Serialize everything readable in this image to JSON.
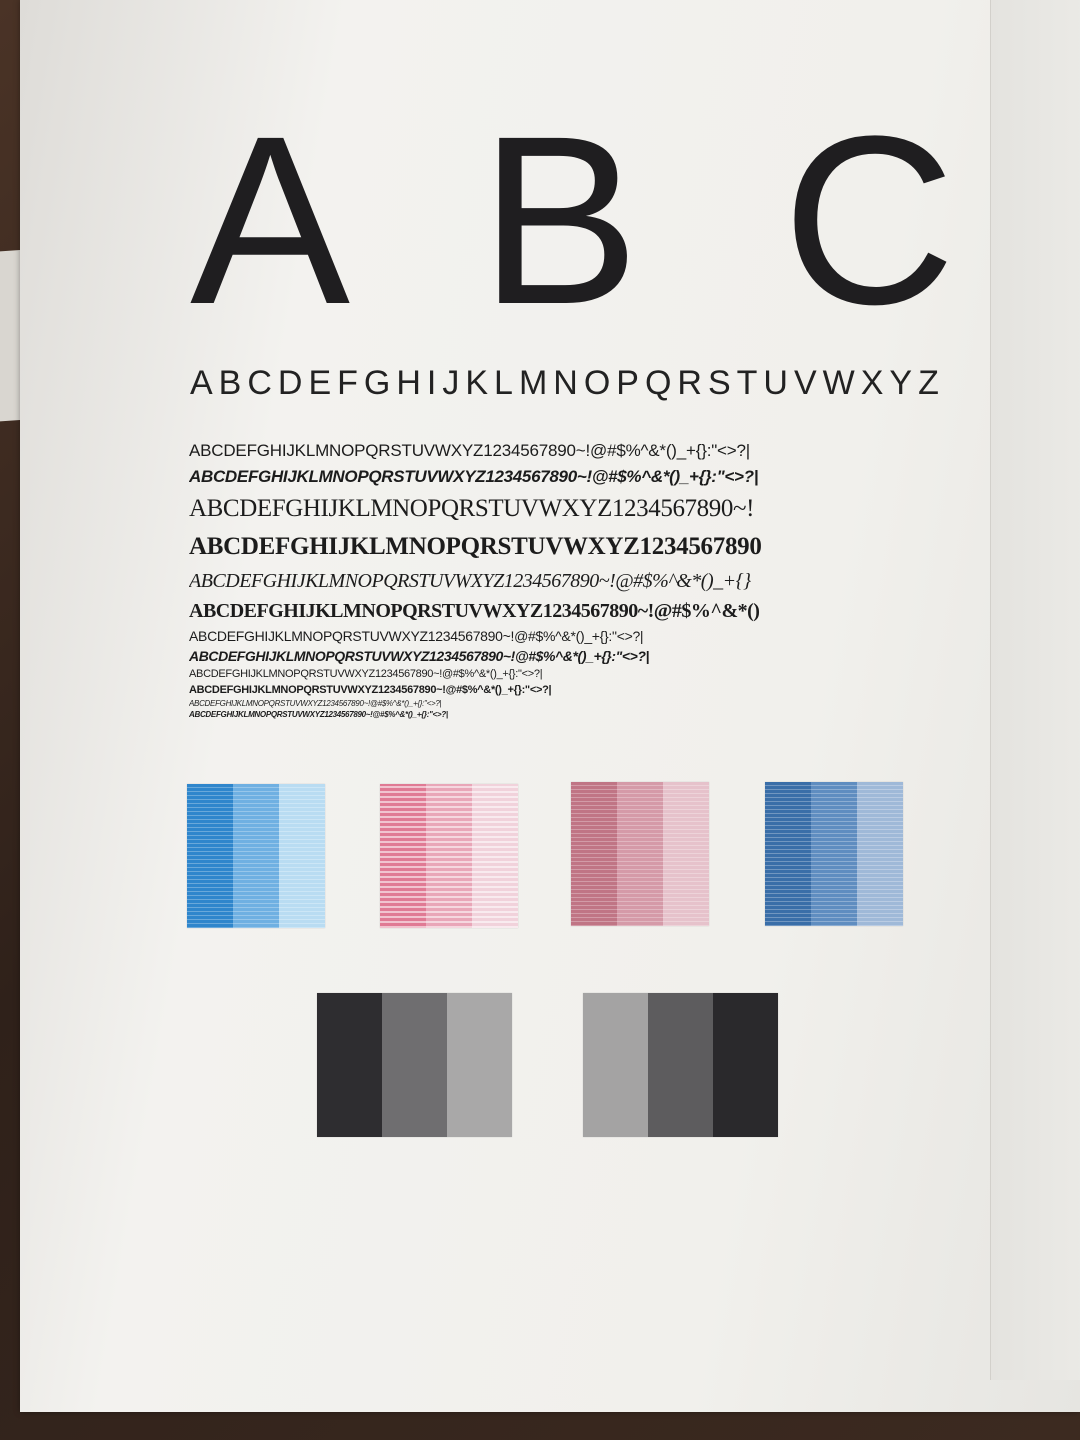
{
  "print_test": {
    "big_letters": "A B C",
    "alphabet_line": "ABCDEFGHIJKLMNOPQRSTUVWXYZ",
    "font_lines": [
      "ABCDEFGHIJKLMNOPQRSTUVWXYZ1234567890~!@#$%^&*()_+{}:\"<>?|",
      "ABCDEFGHIJKLMNOPQRSTUVWXYZ1234567890~!@#$%^&*()_+{}:\"<>?|",
      "ABCDEFGHIJKLMNOPQRSTUVWXYZ1234567890~!",
      "ABCDEFGHIJKLMNOPQRSTUVWXYZ1234567890",
      "ABCDEFGHIJKLMNOPQRSTUVWXYZ1234567890~!@#$%^&*()_+{}",
      "ABCDEFGHIJKLMNOPQRSTUVWXYZ1234567890~!@#$%^&*()",
      "ABCDEFGHIJKLMNOPQRSTUVWXYZ1234567890~!@#$%^&*()_+{}:\"<>?|",
      "ABCDEFGHIJKLMNOPQRSTUVWXYZ1234567890~!@#$%^&*()_+{}:\"<>?|",
      "ABCDEFGHIJKLMNOPQRSTUVWXYZ1234567890~!@#$%^&*()_+{}:\"<>?|",
      "ABCDEFGHIJKLMNOPQRSTUVWXYZ1234567890~!@#$%^&*()_+{}:\"<>?|",
      "ABCDEFGHIJKLMNOPQRSTUVWXYZ1234567890~!@#$%^&*()_+{}:\"<>?|",
      "ABCDEFGHIJKLMNOPQRSTUVWXYZ1234567890~!@#$%^&*()_+{}:\"<>?|"
    ],
    "color_swatches": {
      "cyan": [
        "#2f86cc",
        "#6fb0e2",
        "#b9dcf2"
      ],
      "light_magenta": [
        "#e07a94",
        "#e9a6b8",
        "#f1d2db"
      ],
      "magenta": [
        "#c07585",
        "#d59aa8",
        "#e6c2cb"
      ],
      "blue": [
        "#3a6ea8",
        "#5f8dc0",
        "#9fb9d8"
      ]
    },
    "gray_swatches": {
      "left": [
        "#2e2d30",
        "#6f6e70",
        "#a9a8a8"
      ],
      "right": [
        "#a4a3a3",
        "#5d5c5e",
        "#2a292c"
      ]
    }
  }
}
